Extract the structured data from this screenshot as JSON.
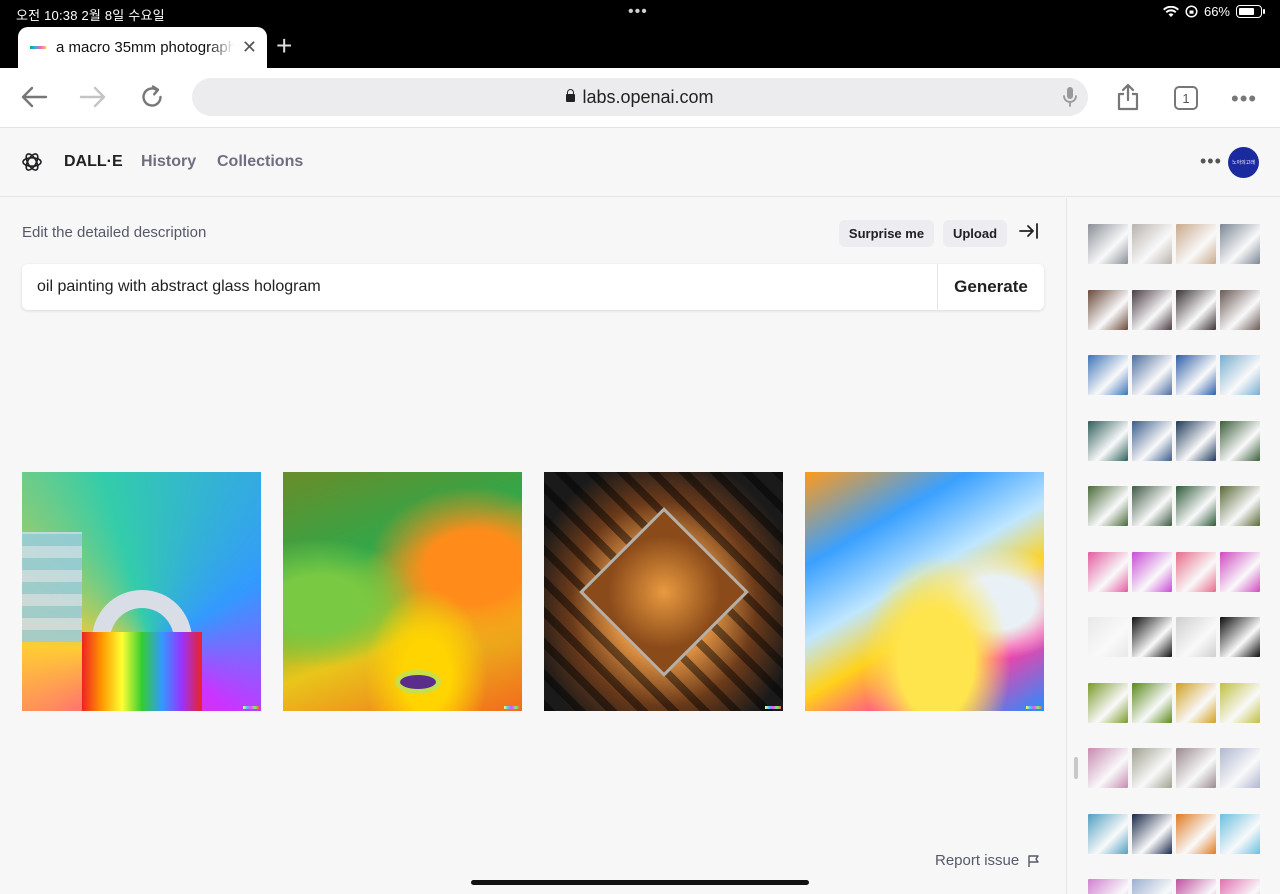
{
  "status": {
    "time": "오전 10:38   2월 8일 수요일",
    "battery": "66%"
  },
  "browser": {
    "tab_title": "a macro 35mm photograph",
    "url": "labs.openai.com",
    "tab_count": "1"
  },
  "nav": {
    "brand": "DALL·E",
    "history": "History",
    "collections": "Collections",
    "avatar_text": "노아의고래"
  },
  "editor": {
    "description_label": "Edit the detailed description",
    "surprise_label": "Surprise me",
    "upload_label": "Upload",
    "prompt_value": "oil painting with abstract glass hologram",
    "generate_label": "Generate"
  },
  "footer": {
    "report_label": "Report issue"
  },
  "history_rows": [
    [
      "#8a8f96",
      "#b9b3ad",
      "#c9a98a",
      "#7c8794"
    ],
    [
      "#6b4a3a",
      "#4a3c44",
      "#3b3336",
      "#6a5a55"
    ],
    [
      "#3d74b8",
      "#4e6fa0",
      "#2e5fa8",
      "#78aed0"
    ],
    [
      "#2f5f5a",
      "#3b5c8a",
      "#1f3a5a",
      "#3b5f3a"
    ],
    [
      "#4a6a3a",
      "#3f5a44",
      "#2f5a3a",
      "#5a6a3a"
    ],
    [
      "#e35ca0",
      "#c94bd6",
      "#e86b8a",
      "#d04ac0"
    ],
    [
      "#e8e8e8",
      "#111111",
      "#cfcfcf",
      "#0d0d0d"
    ],
    [
      "#7a9a2a",
      "#5a8a1a",
      "#d0a020",
      "#c0c040"
    ],
    [
      "#c88ab0",
      "#a0a090",
      "#9a8a90",
      "#b0b8d0"
    ],
    [
      "#50a0c0",
      "#1a2a4a",
      "#e07a20",
      "#6ac0e0"
    ],
    [
      "#d080d0",
      "#9ab0d0",
      "#c050a0",
      "#e070b0"
    ]
  ],
  "colors": {
    "brand_text": "#202123",
    "muted_text": "#6e6e80",
    "avatar_bg": "#1c2aa0"
  }
}
